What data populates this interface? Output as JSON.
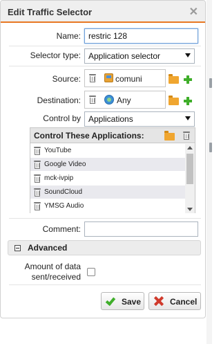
{
  "dialog": {
    "title": "Edit Traffic Selector",
    "close_icon": "close-icon"
  },
  "form": {
    "name_label": "Name:",
    "name_value": "restric 128",
    "selector_type_label": "Selector type:",
    "selector_type_value": "Application selector",
    "source_label": "Source:",
    "source_value": "comuni",
    "destination_label": "Destination:",
    "destination_value": "Any",
    "control_by_label": "Control by",
    "control_by_value": "Applications",
    "comment_label": "Comment:",
    "comment_value": ""
  },
  "applications": {
    "header": "Control These Applications:",
    "items": [
      {
        "name": "YouTube"
      },
      {
        "name": "Google Video"
      },
      {
        "name": "mck-ivpip"
      },
      {
        "name": "SoundCloud"
      },
      {
        "name": "YMSG Audio"
      }
    ]
  },
  "advanced": {
    "title": "Advanced",
    "data_amount_label_line1": "Amount of data",
    "data_amount_label_line2": "sent/received",
    "data_amount_checked": false
  },
  "buttons": {
    "save": "Save",
    "cancel": "Cancel"
  },
  "colors": {
    "accent": "#e87722",
    "add": "#3fae2a",
    "cancel": "#d03a2c",
    "folder": "#f0a630"
  }
}
